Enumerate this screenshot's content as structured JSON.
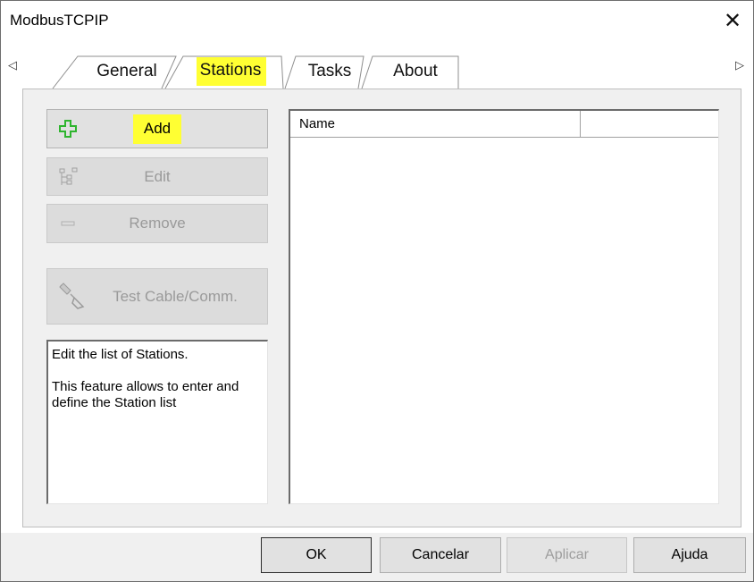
{
  "window": {
    "title": "ModbusTCPIP",
    "close_glyph": "✕"
  },
  "tabs": {
    "scroll_left": "◁",
    "scroll_right": "▷",
    "items": [
      {
        "label": "General",
        "selected": false
      },
      {
        "label": "Stations",
        "selected": true,
        "highlighted": true
      },
      {
        "label": "Tasks",
        "selected": false
      },
      {
        "label": "About",
        "selected": false
      }
    ]
  },
  "actions": {
    "add": {
      "label": "Add",
      "icon": "plus-icon",
      "enabled": true,
      "highlighted": true
    },
    "edit": {
      "label": "Edit",
      "icon": "tree-icon",
      "enabled": false
    },
    "remove": {
      "label": "Remove",
      "icon": "minus-icon",
      "enabled": false
    },
    "test": {
      "label": "Test Cable/Comm.",
      "icon": "cable-plug-icon",
      "enabled": false
    }
  },
  "description": {
    "line1": "Edit the list of Stations.",
    "line2": "This feature allows to enter and define the Station list"
  },
  "list": {
    "columns": [
      "Name",
      ""
    ],
    "rows": []
  },
  "footer": {
    "ok": "OK",
    "cancel": "Cancelar",
    "apply": "Aplicar",
    "help": "Ajuda"
  },
  "colors": {
    "highlight": "#ffff33",
    "plus_icon": "#2fb52f",
    "disabled_text": "#9a9a9a"
  }
}
